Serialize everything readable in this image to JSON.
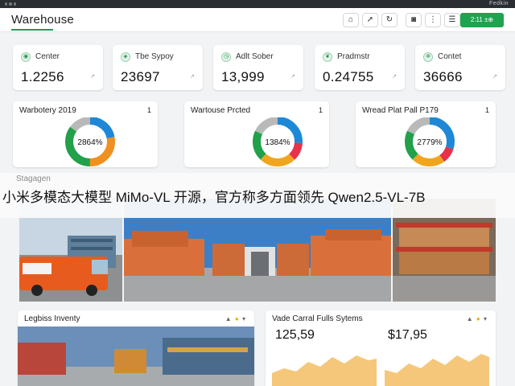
{
  "titlebar": {
    "right_text": "Fedkin"
  },
  "header": {
    "brand": "Warehouse",
    "icons": [
      "home-icon",
      "pin-icon",
      "refresh-icon"
    ],
    "icons2": [
      "camera-icon",
      "more-icon",
      "menu-icon"
    ],
    "action_button": "2:11 ±⊕"
  },
  "stats": [
    {
      "label": "Center",
      "value": "1.2256",
      "mini": "↗"
    },
    {
      "label": "Tbe Sypoy",
      "value": "23697",
      "mini": "↗"
    },
    {
      "label": "Adlt Sober",
      "value": "13,999",
      "mini": "↗"
    },
    {
      "label": "Pradmstr",
      "value": "0.24755",
      "mini": "↗"
    },
    {
      "label": "Contet",
      "value": "36666",
      "mini": "↗"
    }
  ],
  "donuts": [
    {
      "title": "Warbotery 2019",
      "num": "1",
      "center": "2864%",
      "colors": [
        "#1e88d6",
        "#f0901e",
        "#22a04a",
        "#b9b9b9"
      ],
      "segments": [
        0.22,
        0.28,
        0.35,
        0.15
      ]
    },
    {
      "title": "Wartouse Prcted",
      "num": "1",
      "center": "1384%",
      "colors": [
        "#1e88d6",
        "#e8314a",
        "#f0a51e",
        "#22a04a",
        "#b9b9b9"
      ],
      "segments": [
        0.26,
        0.12,
        0.24,
        0.2,
        0.18
      ]
    },
    {
      "title": "Wread Plat Pall P179",
      "num": "1",
      "center": "2779%",
      "colors": [
        "#1e88d6",
        "#e8314a",
        "#f0a51e",
        "#22a04a",
        "#b9b9b9"
      ],
      "segments": [
        0.3,
        0.1,
        0.22,
        0.2,
        0.18
      ]
    }
  ],
  "banner": {
    "subtitle": "Stagagen",
    "text": "小米多模态大模型 MiMo-VL 开源，官方称多方面领先 Qwen2.5-VL-7B"
  },
  "bottom": {
    "left_title": "Legbiss Inventy",
    "right_title": "Vade Carral Fulls Sytems",
    "controls": "▲ ● ▾",
    "fin": [
      {
        "value": "125,59",
        "sub": ""
      },
      {
        "value": "$17,95",
        "sub": ""
      }
    ]
  }
}
